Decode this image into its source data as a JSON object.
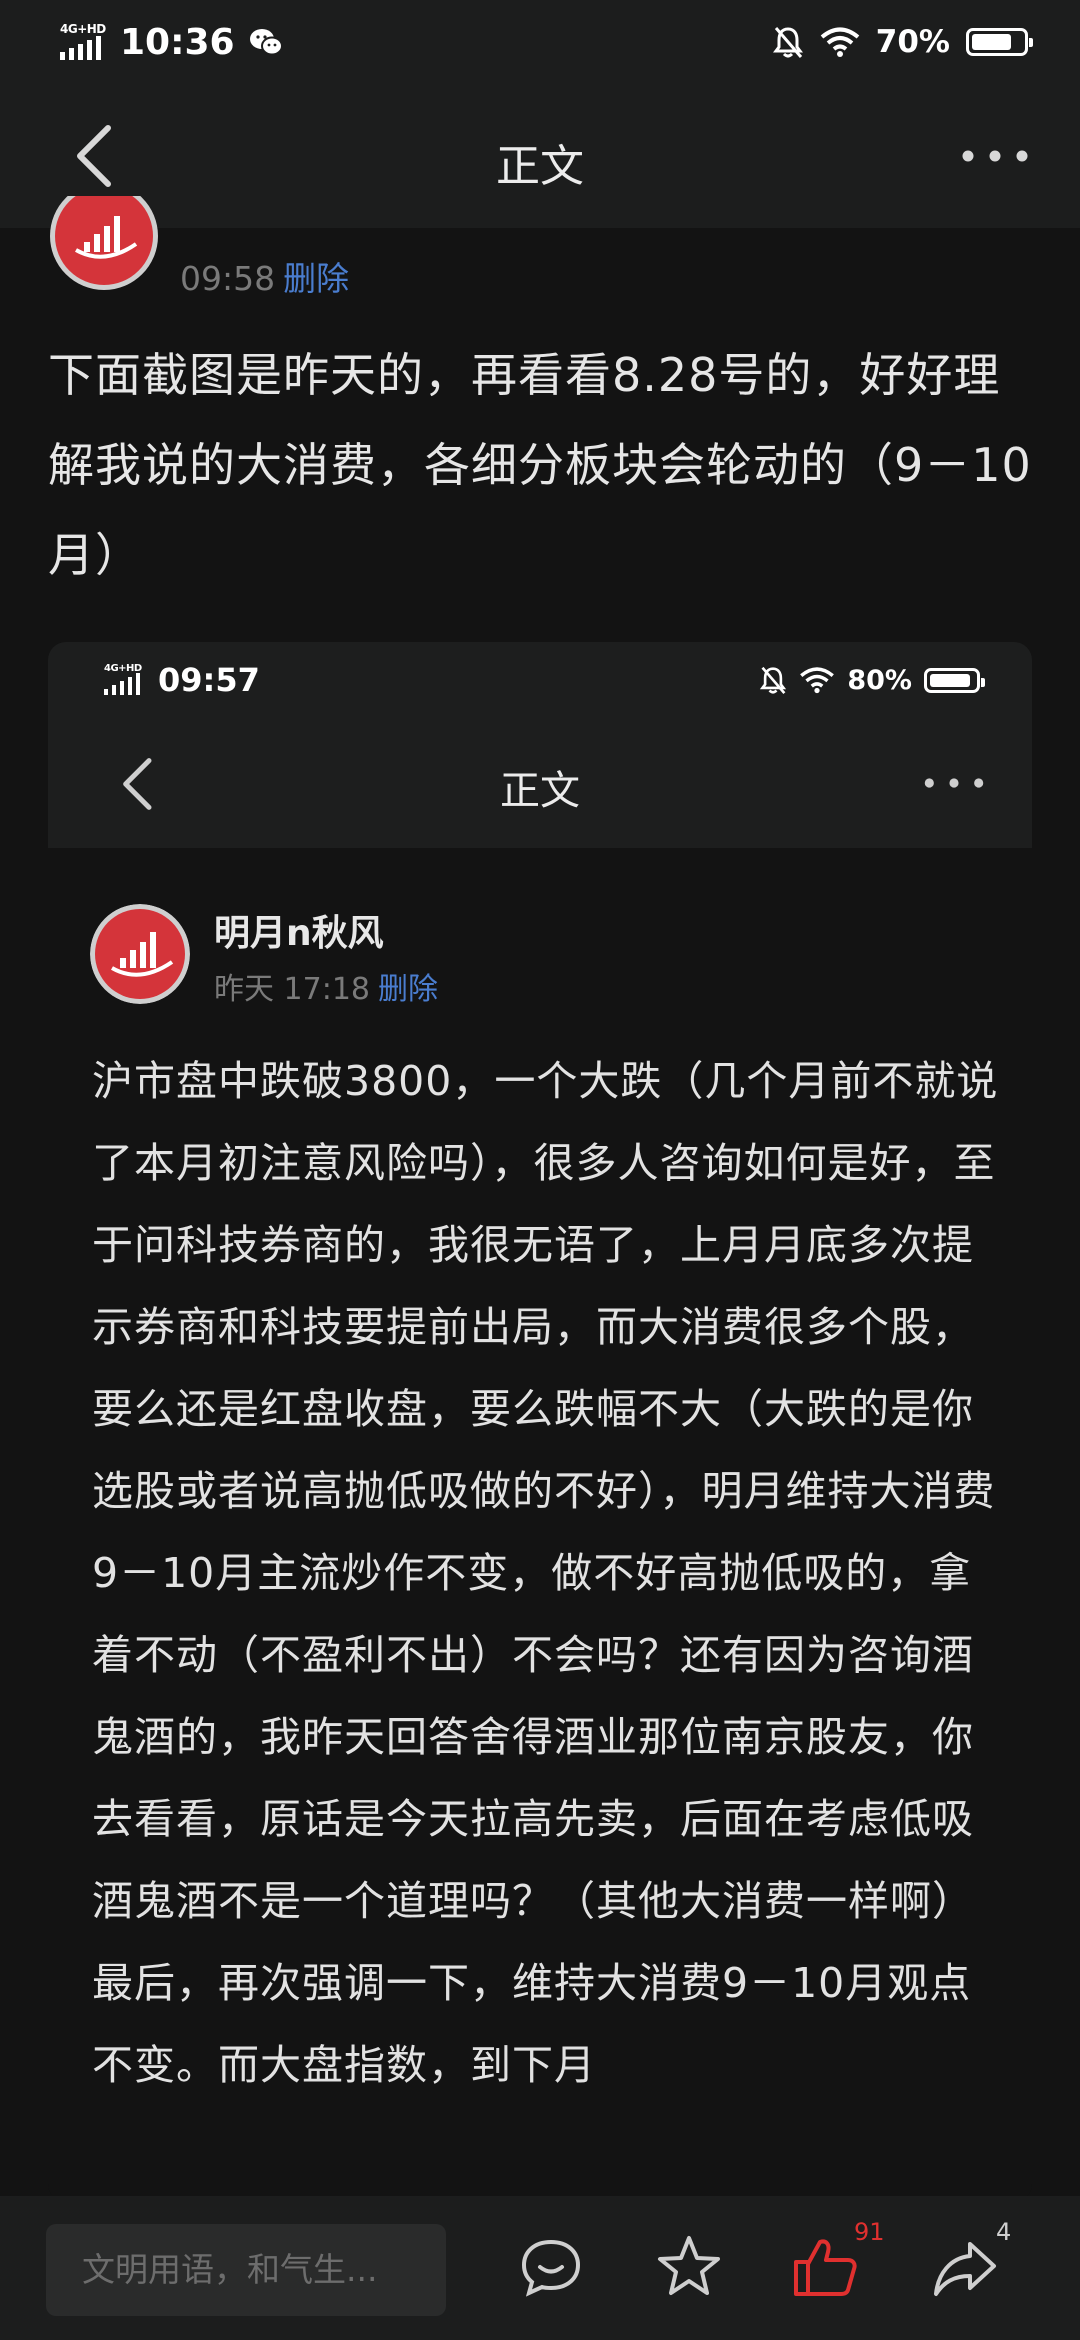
{
  "status_bar": {
    "network": "4G+HD",
    "time": "10:36",
    "battery": "70%",
    "battery_level": 0.7,
    "icons": [
      "wechat-icon",
      "mute-bell-icon",
      "wifi-icon",
      "battery-icon"
    ]
  },
  "nav": {
    "title": "正文",
    "back_icon": "back-chevron-icon",
    "more_icon": "more-dots-icon"
  },
  "post": {
    "time": "09:58",
    "delete_label": "删除",
    "text": "下面截图是昨天的，再看看8.28号的，好好理解我说的大消费，各细分板块会轮动的（9－10月）"
  },
  "embedded": {
    "status_bar": {
      "network": "4G+HD",
      "time": "09:57",
      "battery": "80%",
      "battery_level": 0.8
    },
    "nav": {
      "title": "正文"
    },
    "author": "明月n秋风",
    "meta_time": "昨天 17:18",
    "delete_label": "删除",
    "body": "沪市盘中跌破3800，一个大跌（几个月前不就说了本月初注意风险吗），很多人咨询如何是好，至于问科技券商的，我很无语了，上月月底多次提示券商和科技要提前出局，而大消费很多个股，要么还是红盘收盘，要么跌幅不大（大跌的是你选股或者说高抛低吸做的不好），明月维持大消费9－10月主流炒作不变，做不好高抛低吸的，拿着不动（不盈利不出）不会吗？还有因为咨询酒鬼酒的，我昨天回答舍得酒业那位南京股友，你去看看，原话是今天拉高先卖，后面在考虑低吸酒鬼酒不是一个道理吗？（其他大消费一样啊）最后，再次强调一下，维持大消费9－10月观点不变。而大盘指数，到下月"
  },
  "toolbar": {
    "comment_placeholder": "文明用语，和气生...",
    "like_count": "91",
    "share_count": "4",
    "colors": {
      "like": "#e0302f",
      "link": "#4a7dcf"
    }
  }
}
